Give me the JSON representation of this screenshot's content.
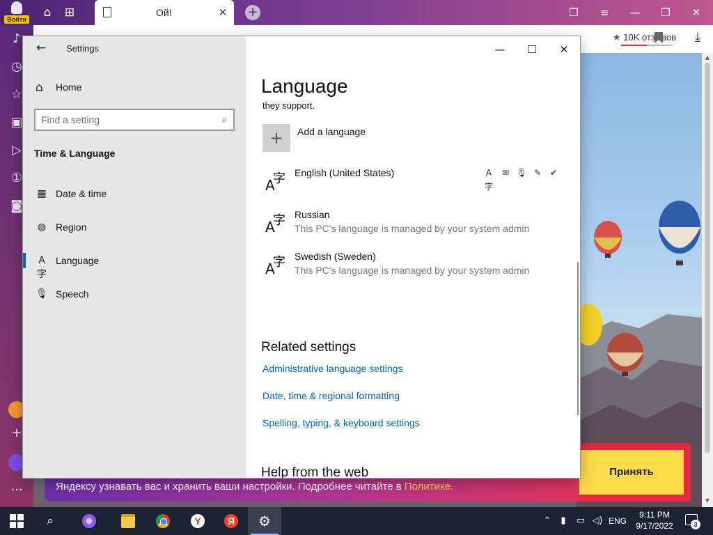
{
  "browser": {
    "login_label": "Войти",
    "tab_title": "Ой!",
    "reviews_label": "10K отзывов",
    "cookie_text": "Яндексу узнавать вас и хранить ваши настройки. Подробнее читайте в ",
    "cookie_link": "Политике",
    "cookie_period": ".",
    "accept_label": "Принять"
  },
  "settings": {
    "app_title": "Settings",
    "home_label": "Home",
    "search_placeholder": "Find a setting",
    "section_title": "Time & Language",
    "nav_items": [
      {
        "label": "Date & time",
        "icon": "calendar-clock-icon"
      },
      {
        "label": "Region",
        "icon": "globe-icon"
      },
      {
        "label": "Language",
        "icon": "language-icon",
        "selected": true
      },
      {
        "label": "Speech",
        "icon": "microphone-icon"
      }
    ],
    "page_title": "Language",
    "support_text": "they support.",
    "add_language_label": "Add a language",
    "languages": [
      {
        "name": "English (United States)",
        "note": ""
      },
      {
        "name": "Russian",
        "note": "This PC's language is managed by your system admin"
      },
      {
        "name": "Swedish (Sweden)",
        "note": "This PC's language is managed by your system admin"
      }
    ],
    "english_features": [
      "display-language-icon",
      "text-to-speech-icon",
      "speech-recognition-icon",
      "handwriting-icon",
      "spellcheck-icon"
    ],
    "related_title": "Related settings",
    "related_links": [
      "Administrative language settings",
      "Date, time & regional formatting",
      "Spelling, typing, & keyboard settings"
    ],
    "help_title": "Help from the web"
  },
  "taskbar": {
    "language_indicator": "ENG",
    "time": "9:11 PM",
    "date": "9/17/2022",
    "notification_count": "3"
  },
  "colors": {
    "accent": "#0067c0",
    "link": "#0067b8",
    "nav_pane_bg": "#e6e6e6",
    "taskbar_bg": "#1c2433",
    "accept_button": "#fcdb4a"
  }
}
